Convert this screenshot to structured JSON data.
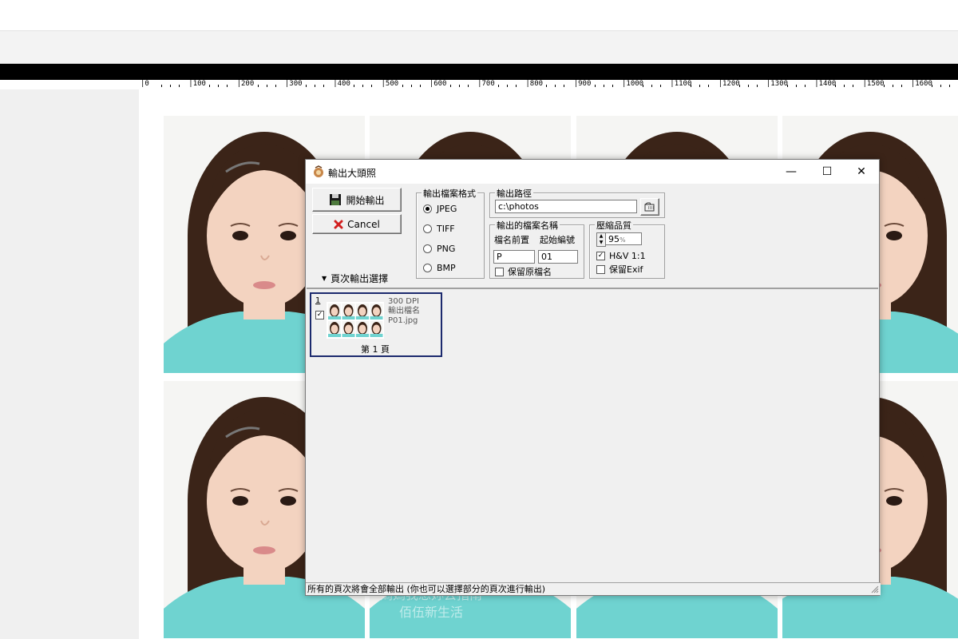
{
  "ruler": {
    "labels": [
      "0",
      "100",
      "200",
      "300",
      "400",
      "500",
      "600",
      "700",
      "800",
      "900",
      "1000",
      "1100",
      "1200",
      "1300",
      "1400",
      "1500",
      "1600"
    ]
  },
  "watermark": {
    "line1": "媽媽我想妳去指南",
    "line2": "佰伍新生活"
  },
  "dialog": {
    "title": "輸出大頭照",
    "minimize_glyph": "—",
    "maximize_glyph": "☐",
    "close_glyph": "✕",
    "start_button": "開始輸出",
    "cancel_button": "Cancel",
    "format": {
      "label": "輸出檔案格式",
      "options": [
        "JPEG",
        "TIFF",
        "PNG",
        "BMP"
      ],
      "selected": "JPEG"
    },
    "path": {
      "label": "輸出路徑",
      "value": "c:\\photos"
    },
    "filename": {
      "label": "輸出的檔案名稱",
      "prefix_label": "檔名前置",
      "start_label": "起始編號",
      "prefix_value": "P",
      "start_value": "01",
      "keep_name_label": "保留原檔名",
      "keep_name_checked": false
    },
    "quality": {
      "label": "壓縮品質",
      "value": "95",
      "unit": "%",
      "hv_label": "H&V 1:1",
      "hv_checked": true,
      "exif_label": "保留Exif",
      "exif_checked": false
    },
    "page_options_label": "頁次輸出選擇",
    "page_item": {
      "number": "1",
      "checked": true,
      "dpi": "300 DPI",
      "output_label": "輸出檔名",
      "filename": "P01.jpg",
      "page_label": "第 1 頁"
    },
    "status": "所有的頁次將會全部輸出 (你也可以選擇部分的頁次進行輸出)"
  },
  "colors": {
    "shirt": "#6fd3d0",
    "hair": "#3b2418",
    "skin": "#f3d3c0",
    "thumb_border": "#1c2a6e"
  }
}
